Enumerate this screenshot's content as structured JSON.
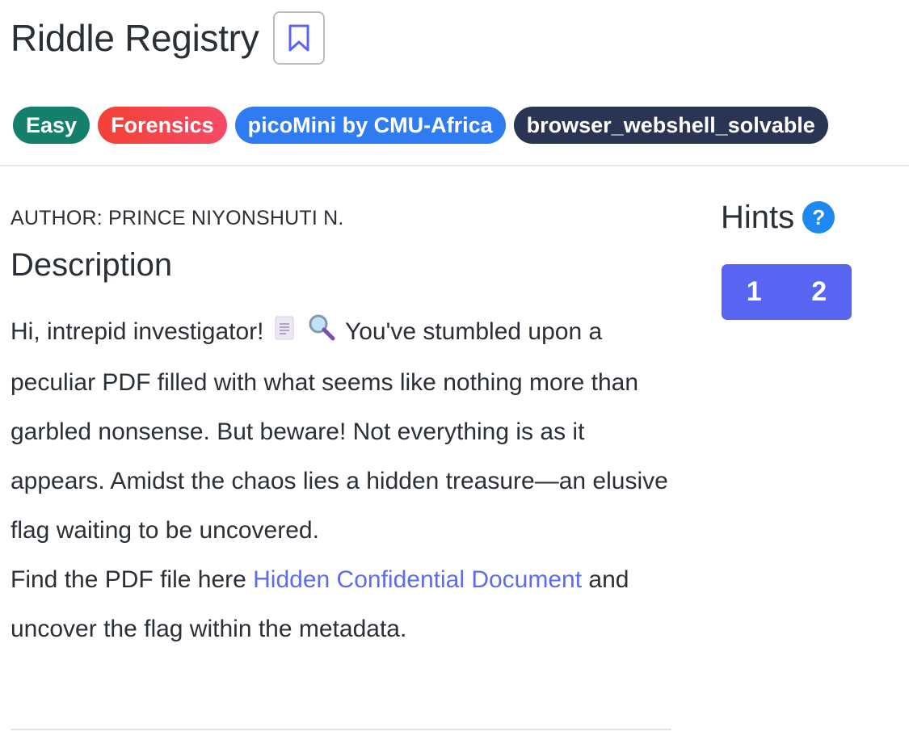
{
  "challenge": {
    "title": "Riddle Registry",
    "bookmark_icon": "bookmark-icon",
    "tags": [
      {
        "label": "Easy",
        "color": "#14806b"
      },
      {
        "label": "Forensics",
        "color": "#f24135"
      },
      {
        "label": "picoMini by CMU-Africa",
        "color": "#2f7bf2"
      },
      {
        "label": "browser_webshell_solvable",
        "color": "#2a3553"
      }
    ],
    "author": "AUTHOR: PRINCE NIYONSHUTI N.",
    "description_heading": "Description",
    "description": {
      "intro": "Hi, intrepid investigator!",
      "emoji_1": "page-icon",
      "emoji_2": "magnifier-icon",
      "body": "You've stumbled upon a peculiar PDF filled with what seems like nothing more than garbled nonsense. But beware! Not everything is as it appears. Amidst the chaos lies a hidden treasure—an elusive flag waiting to be uncovered.",
      "find_prefix": "Find the PDF file here",
      "link_text": "Hidden Confidential Document",
      "find_suffix": "and uncover the flag within the metadata."
    }
  },
  "hints": {
    "title": "Hints",
    "help_icon_text": "?",
    "buttons": [
      "1",
      "2"
    ],
    "button_color": "#5865f2"
  }
}
